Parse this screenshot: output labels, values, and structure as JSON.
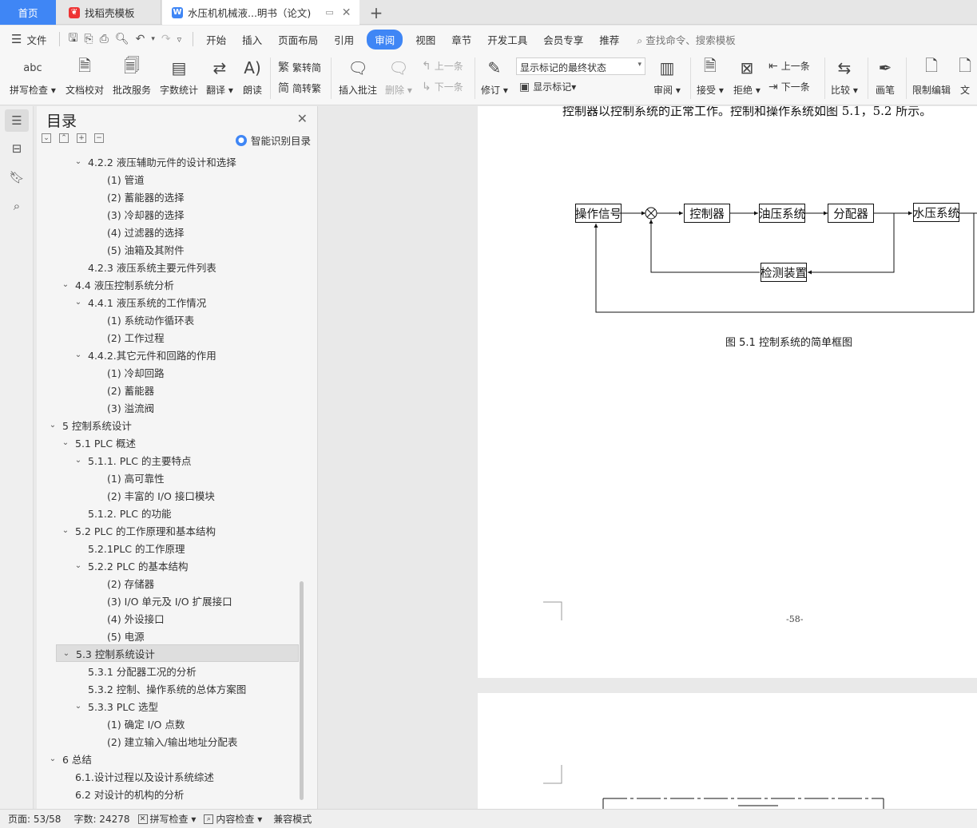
{
  "tabs": {
    "home": "首页",
    "template": "找稻壳模板",
    "document": "水压机机械液...明书（论文)",
    "plus": "+"
  },
  "menu": {
    "file": "文件",
    "items": [
      "开始",
      "插入",
      "页面布局",
      "引用",
      "审阅",
      "视图",
      "章节",
      "开发工具",
      "会员专享",
      "推荐"
    ],
    "active": "审阅",
    "search": "查找命令、搜索模板"
  },
  "ribbon": {
    "spell": "拼写检查",
    "proof": "文档校对",
    "batch": "批改服务",
    "count": "字数统计",
    "translate": "翻译",
    "read": "朗读",
    "trad": "繁转简",
    "simp": "简转繁",
    "insert_comment": "插入批注",
    "delete": "删除",
    "prev_comment": "上一条",
    "next_comment": "下一条",
    "revise": "修订",
    "markup_state": "显示标记的最终状态",
    "show_markup": "显示标记",
    "review": "审阅",
    "accept": "接受",
    "reject": "拒绝",
    "prev_change": "上一条",
    "next_change": "下一条",
    "compare": "比较",
    "pen": "画笔",
    "restrict": "限制编辑",
    "doc_partial": "文"
  },
  "toc": {
    "title": "目录",
    "smart": "智能识别目录",
    "items": [
      {
        "level": 2,
        "text": "4.2.2  液压辅助元件的设计和选择",
        "expand": true
      },
      {
        "level": 3,
        "text": "(1)  管道"
      },
      {
        "level": 3,
        "text": "(2)  蓄能器的选择"
      },
      {
        "level": 3,
        "text": "(3)  冷却器的选择"
      },
      {
        "level": 3,
        "text": "(4)  过滤器的选择"
      },
      {
        "level": 3,
        "text": "(5)  油箱及其附件"
      },
      {
        "level": 2,
        "text": "4.2.3 液压系统主要元件列表"
      },
      {
        "level": 1,
        "text": "4.4  液压控制系统分析",
        "expand": true
      },
      {
        "level": 2,
        "text": "4.4.1  液压系统的工作情况",
        "expand": true
      },
      {
        "level": 3,
        "text": "(1)  系统动作循环表"
      },
      {
        "level": 3,
        "text": "(2)  工作过程"
      },
      {
        "level": 2,
        "text": "4.4.2.其它元件和回路的作用",
        "expand": true
      },
      {
        "level": 3,
        "text": "(1)  冷却回路"
      },
      {
        "level": 3,
        "text": "(2)  蓄能器"
      },
      {
        "level": 3,
        "text": "(3)  溢流阀"
      },
      {
        "level": 0,
        "text": "5    控制系统设计",
        "expand": true
      },
      {
        "level": 1,
        "text": "5.1 PLC 概述",
        "expand": true
      },
      {
        "level": 2,
        "text": "5.1.1.  PLC 的主要特点",
        "expand": true
      },
      {
        "level": 3,
        "text": "(1)  高可靠性"
      },
      {
        "level": 3,
        "text": "(2)  丰富的 I/O 接口模块"
      },
      {
        "level": 2,
        "text": "5.1.2.  PLC 的功能"
      },
      {
        "level": 1,
        "text": "5.2 PLC 的工作原理和基本结构",
        "expand": true
      },
      {
        "level": 2,
        "text": "5.2.1PLC 的工作原理"
      },
      {
        "level": 2,
        "text": "5.2.2 PLC 的基本结构",
        "expand": true
      },
      {
        "level": 3,
        "text": "(2)  存储器"
      },
      {
        "level": 3,
        "text": "(3)  I/O 单元及 I/O 扩展接口"
      },
      {
        "level": 3,
        "text": "(4)  外设接口"
      },
      {
        "level": 3,
        "text": "(5)  电源"
      },
      {
        "level": 1,
        "text": "5.3  控制系统设计",
        "expand": true,
        "selected": true
      },
      {
        "level": 2,
        "text": "5.3.1 分配器工况的分析"
      },
      {
        "level": 2,
        "text": "5.3.2  控制、操作系统的总体方案图"
      },
      {
        "level": 2,
        "text": "5.3.3 PLC 选型",
        "expand": true
      },
      {
        "level": 3,
        "text": "(1)  确定 I/O 点数"
      },
      {
        "level": 3,
        "text": "(2)  建立输入/输出地址分配表"
      },
      {
        "level": 0,
        "text": "6    总结",
        "expand": true
      },
      {
        "level": 1,
        "text": "6.1.设计过程以及设计系统综述"
      },
      {
        "level": 1,
        "text": "6.2 对设计的机构的分析"
      }
    ]
  },
  "document": {
    "body_line": "控制器以控制系统的正常工作。控制和操作系统如图 5.1，5.2 所示。",
    "blocks": {
      "operation_signal": "操作信号",
      "controller": "控制器",
      "hydraulic_system": "油压系统",
      "distributor": "分配器",
      "water_press_system": "水压系统",
      "detection": "检测装置"
    },
    "caption": "图 5.1  控制系统的简单框图",
    "page_number": "-58-"
  },
  "status": {
    "page": "页面: 53/58",
    "words": "字数: 24278",
    "spell": "拼写检查",
    "content_check": "内容检查",
    "compat": "兼容模式"
  },
  "colors": {
    "accent": "#3f86f5"
  }
}
